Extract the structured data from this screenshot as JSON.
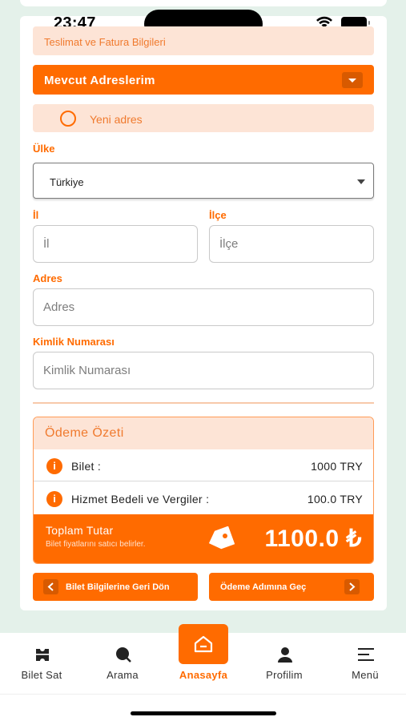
{
  "status_bar": {
    "time": "23:47"
  },
  "section_header": "Teslimat ve Fatura Bilgileri",
  "address_select": {
    "label": "Mevcut Adreslerim"
  },
  "new_address": {
    "label": "Yeni adres"
  },
  "form": {
    "country": {
      "label": "Ülke",
      "value": "Türkiye"
    },
    "province": {
      "label": "İl",
      "placeholder": "İl"
    },
    "district": {
      "label": "İlçe",
      "placeholder": "İlçe"
    },
    "address": {
      "label": "Adres",
      "placeholder": "Adres"
    },
    "id_number": {
      "label": "Kimlik Numarası",
      "placeholder": "Kimlik Numarası"
    }
  },
  "summary": {
    "title": "Ödeme Özeti",
    "rows": [
      {
        "label": "Bilet :",
        "value": "1000 TRY"
      },
      {
        "label": "Hizmet Bedeli ve Vergiler :",
        "value": "100.0 TRY"
      }
    ],
    "total_label": "Toplam Tutar",
    "total_note": "Bilet fiyatlarını satıcı belirler.",
    "total_amount": "1100.0 ₺"
  },
  "buttons": {
    "back": "Bilet Bilgilerine Geri Dön",
    "next": "Ödeme Adımına Geç"
  },
  "tabbar": {
    "items": [
      {
        "label": "Bilet Sat",
        "icon": "ticket-icon"
      },
      {
        "label": "Arama",
        "icon": "search-icon"
      },
      {
        "label": "Anasayfa",
        "icon": "home-icon"
      },
      {
        "label": "Profilim",
        "icon": "person-icon"
      },
      {
        "label": "Menü",
        "icon": "menu-icon"
      }
    ]
  },
  "colors": {
    "accent": "#ff6b00",
    "accent_light": "#fde4d6",
    "background": "#e4f1ea"
  }
}
